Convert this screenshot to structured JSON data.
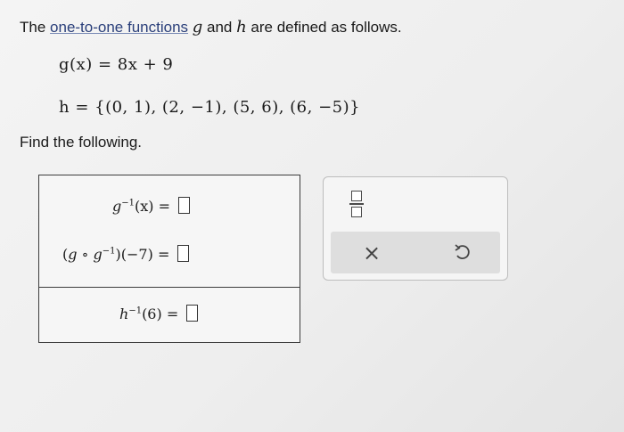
{
  "prompt": {
    "prefix": "The ",
    "link": "one-to-one functions",
    "var_g": "g",
    "and": " and ",
    "var_h": "h",
    "suffix": " are defined as follows."
  },
  "definitions": {
    "g_def": "g(x) = 8x + 9",
    "h_def": "h = {(0, 1), (2, −1), (5, 6), (6, −5)}"
  },
  "find_label": "Find the following.",
  "questions": [
    {
      "id": "g_inverse_x",
      "base": "g",
      "exp": "−1",
      "arg": "(x)",
      "equals": "="
    },
    {
      "id": "composition",
      "left": "(",
      "g1": "g",
      "circ": " ∘ ",
      "g2": "g",
      "exp": "−1",
      "close": ")",
      "arg": "(−7)",
      "equals": "="
    },
    {
      "id": "h_inverse_6",
      "base": "h",
      "exp": "−1",
      "arg": "(6)",
      "equals": "="
    }
  ],
  "tools": {
    "fraction_icon": "fraction-icon",
    "clear_label": "×",
    "undo_icon": "undo-icon"
  }
}
